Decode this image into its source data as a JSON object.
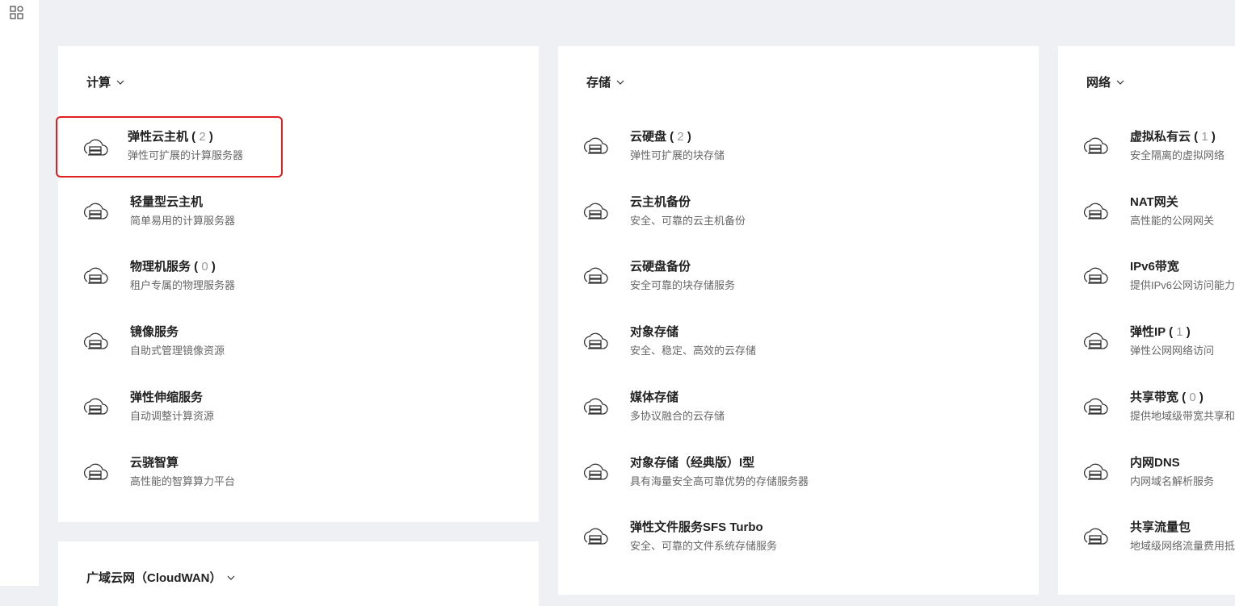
{
  "sections": [
    {
      "title": "计算",
      "items": [
        {
          "name": "弹性云主机",
          "count": "2",
          "desc": "弹性可扩展的计算服务器",
          "icon": "cloud-server-icon",
          "highlight": true
        },
        {
          "name": "轻量型云主机",
          "desc": "简单易用的计算服务器",
          "icon": "light-cloud-server-icon"
        },
        {
          "name": "物理机服务",
          "count": "0",
          "desc": "租户专属的物理服务器",
          "icon": "physical-server-icon"
        },
        {
          "name": "镜像服务",
          "desc": "自助式管理镜像资源",
          "icon": "image-service-icon"
        },
        {
          "name": "弹性伸缩服务",
          "desc": "自动调整计算资源",
          "icon": "auto-scaling-icon"
        },
        {
          "name": "云骁智算",
          "desc": "高性能的智算算力平台",
          "icon": "ai-compute-icon"
        }
      ]
    },
    {
      "title": "存储",
      "items": [
        {
          "name": "云硬盘",
          "count": "2",
          "desc": "弹性可扩展的块存储",
          "icon": "cube-icon"
        },
        {
          "name": "云主机备份",
          "desc": "安全、可靠的云主机备份",
          "icon": "cloud-backup-icon"
        },
        {
          "name": "云硬盘备份",
          "desc": "安全可靠的块存储服务",
          "icon": "disk-backup-icon"
        },
        {
          "name": "对象存储",
          "desc": "安全、稳定、高效的云存储",
          "icon": "cloud-upload-icon"
        },
        {
          "name": "媒体存储",
          "desc": "多协议融合的云存储",
          "icon": "media-storage-icon"
        },
        {
          "name": "对象存储（经典版）I型",
          "desc": "具有海量安全高可靠优势的存储服务器",
          "icon": "file-icon"
        },
        {
          "name": "弹性文件服务SFS Turbo",
          "desc": "安全、可靠的文件系统存储服务",
          "icon": "file-service-icon"
        }
      ]
    },
    {
      "title": "网络",
      "items": [
        {
          "name": "虚拟私有云",
          "count": "1",
          "desc": "安全隔离的虚拟网络",
          "icon": "vpc-icon"
        },
        {
          "name": "NAT网关",
          "desc": "高性能的公网网关",
          "icon": "nat-gateway-icon"
        },
        {
          "name": "IPv6带宽",
          "desc": "提供IPv6公网访问能力",
          "icon": "ipv6-icon"
        },
        {
          "name": "弹性IP",
          "count": "1",
          "desc": "弹性公网网络访问",
          "icon": "ip-icon"
        },
        {
          "name": "共享带宽",
          "count": "0",
          "desc": "提供地域级带宽共享和复用能力",
          "icon": "router-icon"
        },
        {
          "name": "内网DNS",
          "desc": "内网域名解析服务",
          "icon": "dns-globe-icon"
        },
        {
          "name": "共享流量包",
          "desc": "地域级网络流量费用抵扣",
          "icon": "data-package-icon"
        }
      ]
    },
    {
      "title": "广域云网（CloudWAN）",
      "items": []
    }
  ]
}
